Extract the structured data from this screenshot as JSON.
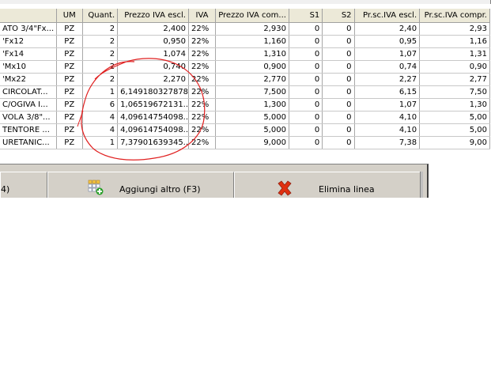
{
  "grid": {
    "columns": [
      {
        "key": "desc",
        "label": "",
        "align": "left"
      },
      {
        "key": "um",
        "label": "UM",
        "align": "center"
      },
      {
        "key": "qty",
        "label": "Quant.",
        "align": "right"
      },
      {
        "key": "price_excl",
        "label": "Prezzo IVA escl.",
        "align": "right"
      },
      {
        "key": "iva",
        "label": "IVA",
        "align": "left"
      },
      {
        "key": "price_incl",
        "label": "Prezzo IVA com...",
        "align": "right"
      },
      {
        "key": "s1",
        "label": "S1",
        "align": "right"
      },
      {
        "key": "s2",
        "label": "S2",
        "align": "right"
      },
      {
        "key": "prsc_excl",
        "label": "Pr.sc.IVA escl.",
        "align": "right"
      },
      {
        "key": "prsc_incl",
        "label": "Pr.sc.IVA compr.",
        "align": "right"
      }
    ],
    "rows": [
      [
        "ATO 3/4\"Fx...",
        "PZ",
        "2",
        "2,400",
        "22%",
        "2,930",
        "0",
        "0",
        "2,40",
        "2,93"
      ],
      [
        "'Fx12",
        "PZ",
        "2",
        "0,950",
        "22%",
        "1,160",
        "0",
        "0",
        "0,95",
        "1,16"
      ],
      [
        "'Fx14",
        "PZ",
        "2",
        "1,074",
        "22%",
        "1,310",
        "0",
        "0",
        "1,07",
        "1,31"
      ],
      [
        "'Mx10",
        "PZ",
        "2",
        "0,740",
        "22%",
        "0,900",
        "0",
        "0",
        "0,74",
        "0,90"
      ],
      [
        "'Mx22",
        "PZ",
        "2",
        "2,270",
        "22%",
        "2,770",
        "0",
        "0",
        "2,27",
        "2,77"
      ],
      [
        "CIRCOLAT...",
        "PZ",
        "1",
        "6,149180327878",
        "22%",
        "7,500",
        "0",
        "0",
        "6,15",
        "7,50"
      ],
      [
        " C/OGIVA I...",
        "PZ",
        "6",
        "1,06519672131...",
        "22%",
        "1,300",
        "0",
        "0",
        "1,07",
        "1,30"
      ],
      [
        "VOLA 3/8\"...",
        "PZ",
        "4",
        "4,09614754098...",
        "22%",
        "5,000",
        "0",
        "0",
        "4,10",
        "5,00"
      ],
      [
        "TENTORE ...",
        "PZ",
        "4",
        "4,09614754098...",
        "22%",
        "5,000",
        "0",
        "0",
        "4,10",
        "5,00"
      ],
      [
        "URETANIC...",
        "PZ",
        "1",
        "7,37901639345...",
        "22%",
        "9,000",
        "0",
        "0",
        "7,38",
        "9,00"
      ]
    ]
  },
  "toolbar": {
    "left_label": "4)",
    "add_label": "Aggiungi altro (F3)",
    "delete_label": "Elimina linea"
  },
  "icons": {
    "add": "add-row-grid-icon",
    "delete": "red-x-delete-icon"
  },
  "annotation_color": "#e02020"
}
